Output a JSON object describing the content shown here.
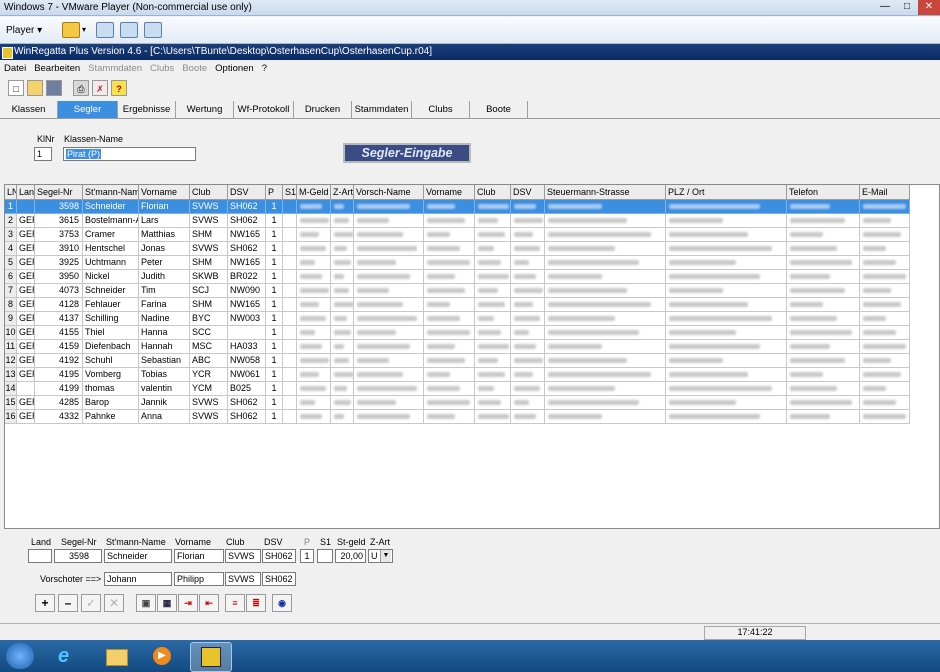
{
  "window": {
    "title": "Windows 7 - VMware Player (Non-commercial use only)"
  },
  "vmware": {
    "player_label": "Player ▾"
  },
  "app": {
    "title": "WinRegatta Plus Version 4.6 - [C:\\Users\\TBunte\\Desktop\\OsterhasenCup\\OsterhasenCup.r04]"
  },
  "menu": [
    "Datei",
    "Bearbeiten",
    "Stammdaten",
    "Clubs",
    "Boote",
    "Optionen",
    "?"
  ],
  "tabs": [
    "Klassen",
    "Segler",
    "Ergebnisse",
    "Wertung",
    "Wf-Protokoll",
    "Drucken",
    "Stammdaten",
    "Clubs",
    "Boote"
  ],
  "form": {
    "klnr_label": "KlNr",
    "klnr_value": "1",
    "klassen_name_label": "Klassen-Name",
    "klassen_name_value": "Pirat  (P)",
    "badge": "Segler-Eingabe"
  },
  "grid": {
    "headers": [
      "LNr",
      "Land",
      "Segel-Nr",
      "St'mann-Name",
      "Vorname",
      "Club",
      "DSV",
      "P",
      "S1",
      "M-Geld",
      "Z-Art",
      "Vorsch-Name",
      "Vorname",
      "Club",
      "DSV",
      "Steuermann-Strasse",
      "PLZ / Ort",
      "Telefon",
      "E-Mail"
    ],
    "rows": [
      [
        "1",
        "",
        "3598",
        "Schneider",
        "Florian",
        "SVWS",
        "SH062",
        "1"
      ],
      [
        "2",
        "GER",
        "3615",
        "Bostelmann-Arp",
        "Lars",
        "SVWS",
        "SH062",
        "1"
      ],
      [
        "3",
        "GER",
        "3753",
        "Cramer",
        "Matthias",
        "SHM",
        "NW165",
        "1"
      ],
      [
        "4",
        "GER",
        "3910",
        "Hentschel",
        "Jonas",
        "SVWS",
        "SH062",
        "1"
      ],
      [
        "5",
        "GER",
        "3925",
        "Uchtmann",
        "Peter",
        "SHM",
        "NW165",
        "1"
      ],
      [
        "6",
        "GER",
        "3950",
        "Nickel",
        "Judith",
        "SKWB",
        "BR022",
        "1"
      ],
      [
        "7",
        "GER",
        "4073",
        "Schneider",
        "Tim",
        "SCJ",
        "NW090",
        "1"
      ],
      [
        "8",
        "GER",
        "4128",
        "Fehlauer",
        "Farina",
        "SHM",
        "NW165",
        "1"
      ],
      [
        "9",
        "GER",
        "4137",
        "Schilling",
        "Nadine",
        "BYC",
        "NW003",
        "1"
      ],
      [
        "10",
        "GER",
        "4155",
        "Thiel",
        "Hanna",
        "SCC",
        "",
        "1"
      ],
      [
        "11",
        "GER",
        "4159",
        "Diefenbach",
        "Hannah",
        "MSC",
        "HA033",
        "1"
      ],
      [
        "12",
        "GER",
        "4192",
        "Schuhl",
        "Sebastian",
        "ABC",
        "NW058",
        "1"
      ],
      [
        "13",
        "GER",
        "4195",
        "Vomberg",
        "Tobias",
        "YCR",
        "NW061",
        "1"
      ],
      [
        "14",
        "",
        "4199",
        "thomas",
        "valentin",
        "YCM",
        "B025",
        "1"
      ],
      [
        "15",
        "GER",
        "4285",
        "Barop",
        "Jannik",
        "SVWS",
        "SH062",
        "1"
      ],
      [
        "16",
        "GER",
        "4332",
        "Pahnke",
        "Anna",
        "SVWS",
        "SH062",
        "1"
      ]
    ]
  },
  "edit": {
    "labels": [
      "Land",
      "Segel-Nr",
      "St'mann-Name",
      "Vorname",
      "Club",
      "DSV",
      "P",
      "S1",
      "St-geld",
      "Z-Art"
    ],
    "land": "",
    "segel_nr": "3598",
    "stmann_name": "Schneider",
    "vorname": "Florian",
    "club": "SVWS",
    "dsv": "SH062",
    "p": "1",
    "s1": "",
    "st_geld": "20,00",
    "z_art": "U",
    "vorschoter_label": "Vorschoter ==>",
    "vs_name": "Johann",
    "vs_vorname": "Philipp",
    "vs_club": "SVWS",
    "vs_dsv": "SH062"
  },
  "status": {
    "clock": "17:41:22"
  },
  "colors": {
    "selection": "#3c8ee0",
    "app_title_bar": "#0a2a63",
    "badge": "#3b4b83"
  }
}
